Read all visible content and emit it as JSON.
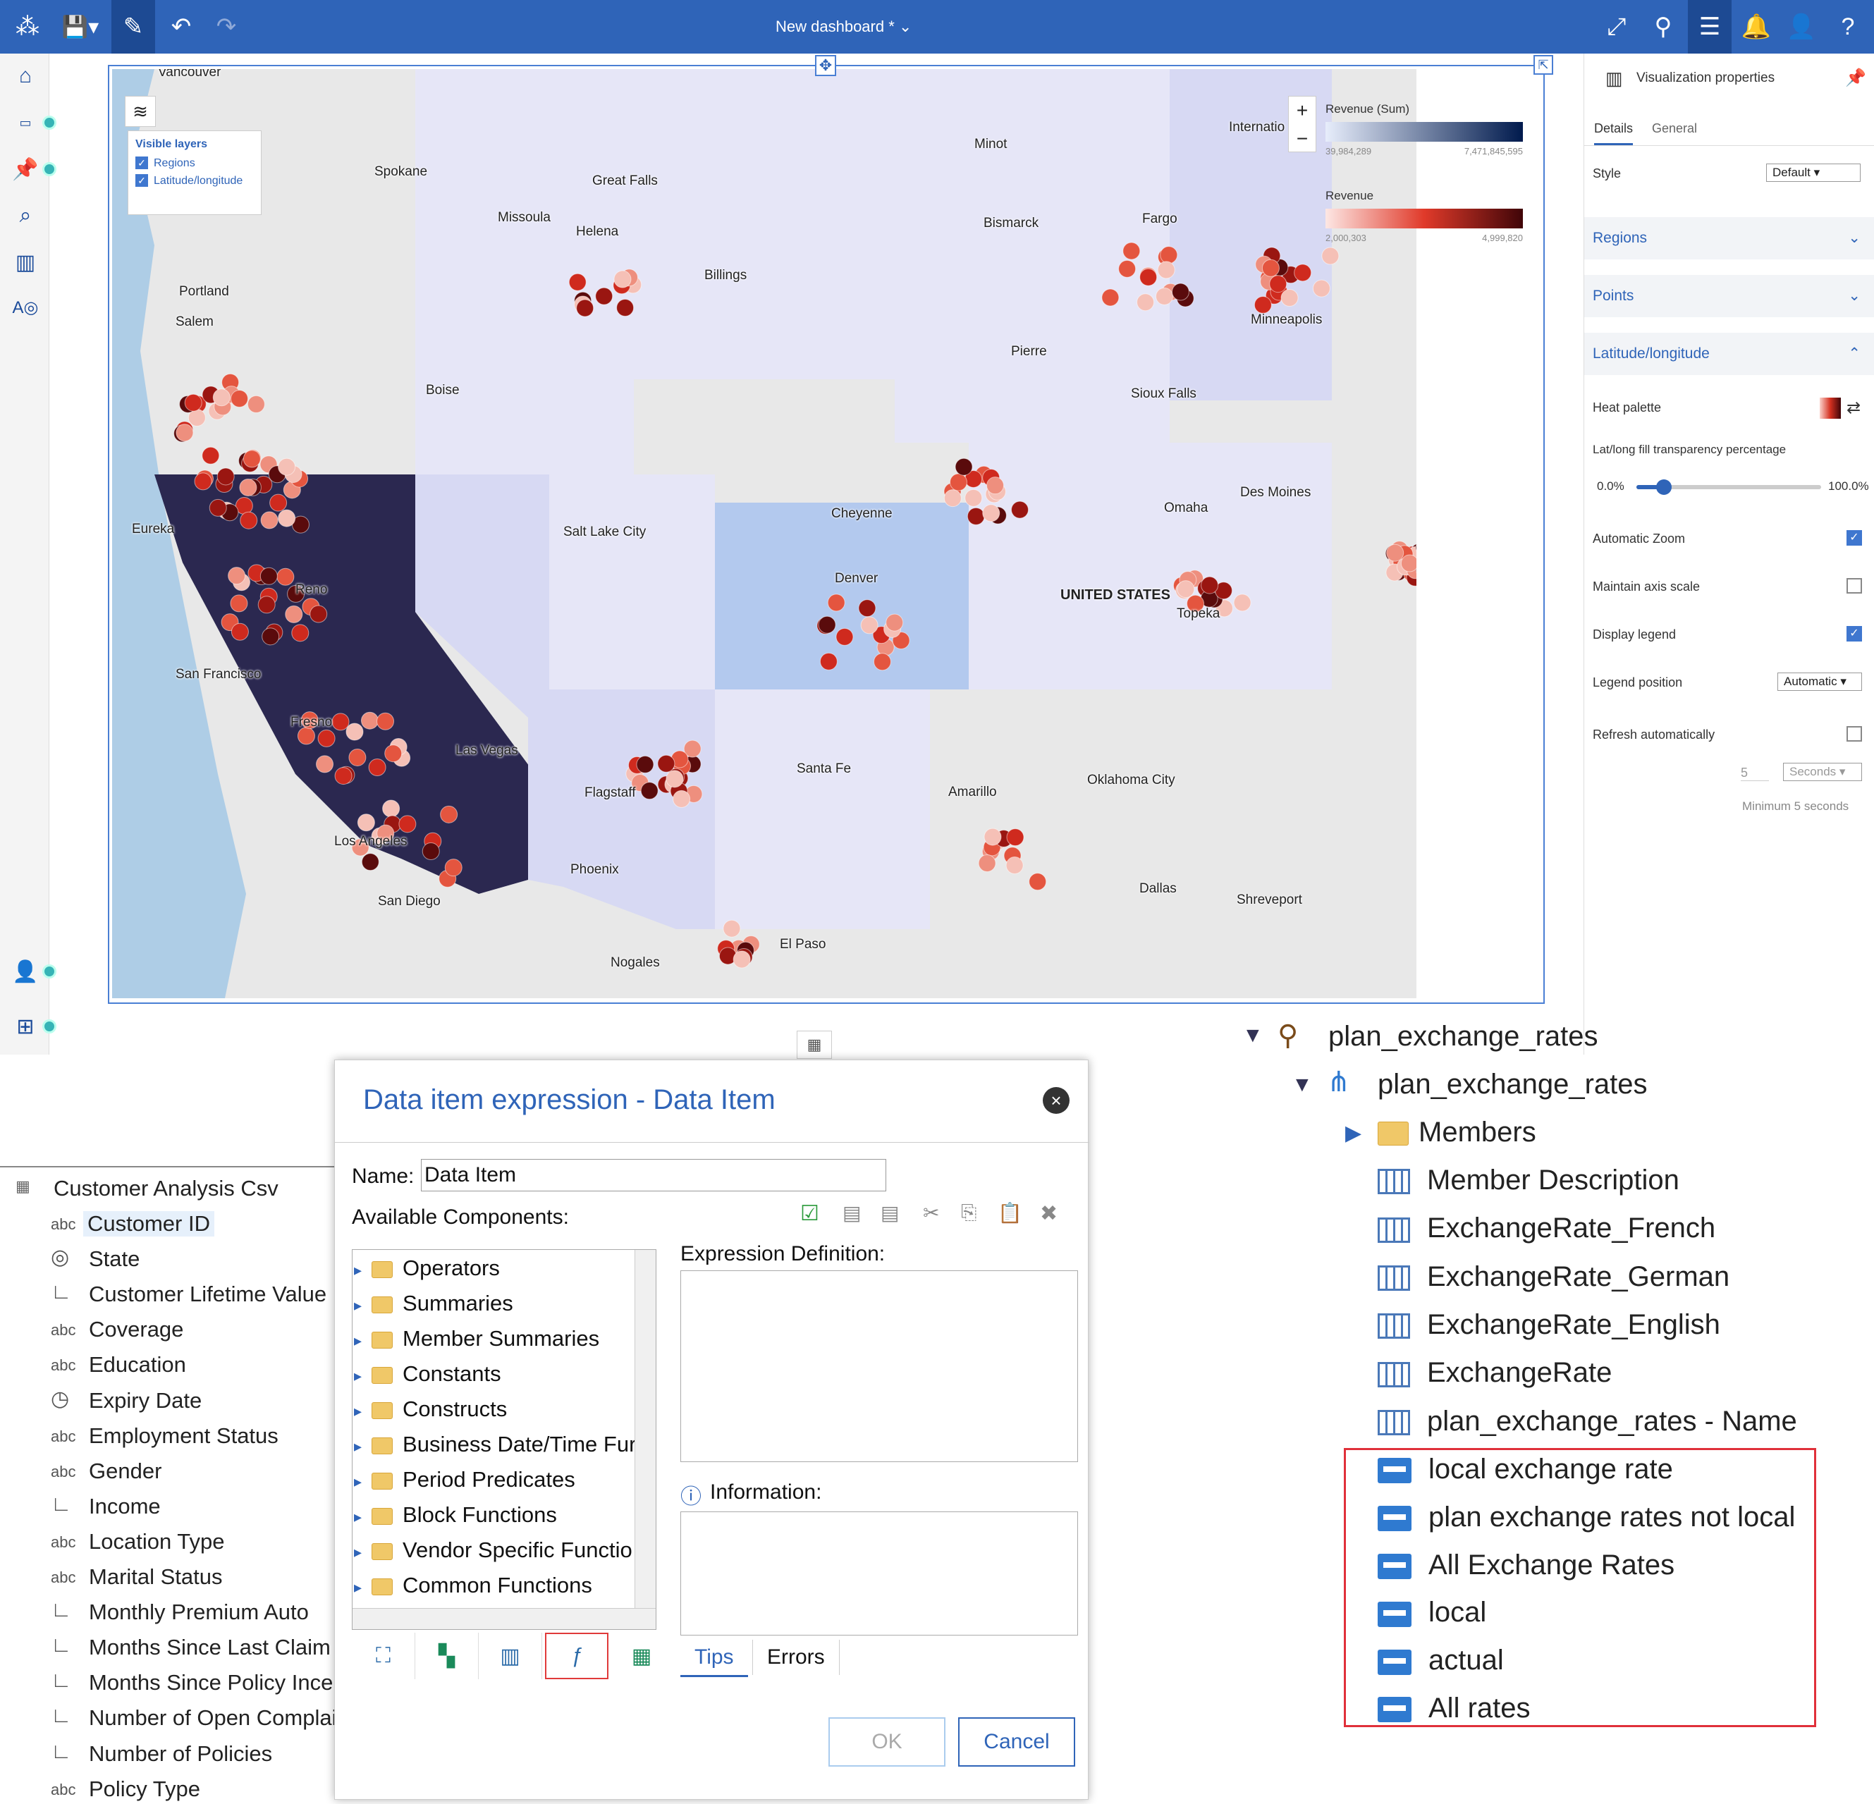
{
  "topbar": {
    "title": "New dashboard *"
  },
  "map": {
    "layers_panel": {
      "title": "Visible layers",
      "layers": [
        "Regions",
        "Latitude/longitude"
      ]
    },
    "zoom_in": "+",
    "zoom_out": "−",
    "legend": {
      "revenue_sum": {
        "title": "Revenue (Sum)",
        "min": "39,984,289",
        "max": "7,471,845,595"
      },
      "revenue": {
        "title": "Revenue",
        "min": "2,000,303",
        "max": "4,999,820"
      }
    },
    "cities": [
      "Vancouver",
      "Spokane",
      "Great Falls",
      "Missoula",
      "Helena",
      "Minot",
      "Bismarck",
      "Fargo",
      "Billings",
      "Portland",
      "Salem",
      "Boise",
      "Pierre",
      "Sioux Falls",
      "Minneapolis",
      "Des Moines",
      "Omaha",
      "Cheyenne",
      "Salt Lake City",
      "Eureka",
      "Reno",
      "San Francisco",
      "Denver",
      "UNITED STATES",
      "Topeka",
      "Fresno",
      "Las Vegas",
      "Flagstaff",
      "Santa Fe",
      "Amarillo",
      "Oklahoma City",
      "Los Angeles",
      "Phoenix",
      "San Diego",
      "Dallas",
      "Shreveport",
      "Nogales",
      "El Paso",
      "Internatio"
    ]
  },
  "props": {
    "title": "Visualization properties",
    "tabs": [
      "Details",
      "General"
    ],
    "style_label": "Style",
    "style_value": "Default",
    "sections": [
      "Regions",
      "Points",
      "Latitude/longitude"
    ],
    "heat_palette": "Heat palette",
    "transparency_label": "Lat/long fill transparency percentage",
    "slider_min": "0.0%",
    "slider_max": "100.0%",
    "slider_value": 0.15,
    "automatic_zoom": "Automatic Zoom",
    "maintain_axis": "Maintain axis scale",
    "display_legend": "Display legend",
    "legend_position": "Legend position",
    "legend_position_value": "Automatic",
    "refresh": "Refresh automatically",
    "refresh_value": "5",
    "refresh_unit": "Seconds",
    "refresh_min": "Minimum 5 seconds"
  },
  "dialog": {
    "title": "Data item expression - Data Item",
    "name_label": "Name:",
    "name_value": "Data Item",
    "available": "Available Components:",
    "components": [
      "Operators",
      "Summaries",
      "Member Summaries",
      "Constants",
      "Constructs",
      "Business Date/Time Fur",
      "Period Predicates",
      "Block Functions",
      "Vendor Specific Functio",
      "Common Functions"
    ],
    "expression_label": "Expression Definition:",
    "information_label": "Information:",
    "tabs": [
      "Tips",
      "Errors"
    ],
    "ok": "OK",
    "cancel": "Cancel"
  },
  "left_tree": {
    "root": "Customer Analysis Csv",
    "items": [
      {
        "icon": "abc",
        "label": "Customer ID"
      },
      {
        "icon": "geo",
        "label": "State"
      },
      {
        "icon": "measure",
        "label": "Customer Lifetime Value"
      },
      {
        "icon": "abc",
        "label": "Coverage"
      },
      {
        "icon": "abc",
        "label": "Education"
      },
      {
        "icon": "time",
        "label": "Expiry Date"
      },
      {
        "icon": "abc",
        "label": "Employment Status"
      },
      {
        "icon": "abc",
        "label": "Gender"
      },
      {
        "icon": "measure",
        "label": "Income"
      },
      {
        "icon": "abc",
        "label": "Location Type"
      },
      {
        "icon": "abc",
        "label": "Marital Status"
      },
      {
        "icon": "measure",
        "label": "Monthly Premium Auto"
      },
      {
        "icon": "measure",
        "label": "Months Since Last Claim"
      },
      {
        "icon": "measure",
        "label": "Months Since Policy Incep"
      },
      {
        "icon": "measure",
        "label": "Number of Open Complair"
      },
      {
        "icon": "measure",
        "label": "Number of Policies"
      },
      {
        "icon": "abc",
        "label": "Policy Type"
      }
    ]
  },
  "right_tree": {
    "root": "plan_exchange_rates",
    "hierarchy": "plan_exchange_rates",
    "members": "Members",
    "columns": [
      "Member Description",
      "ExchangeRate_French",
      "ExchangeRate_German",
      "ExchangeRate_English",
      "ExchangeRate",
      "plan_exchange_rates - Name"
    ],
    "sets": [
      "local exchange rate",
      "plan exchange rates not local",
      "All Exchange Rates",
      "local",
      "actual",
      "All rates"
    ]
  }
}
